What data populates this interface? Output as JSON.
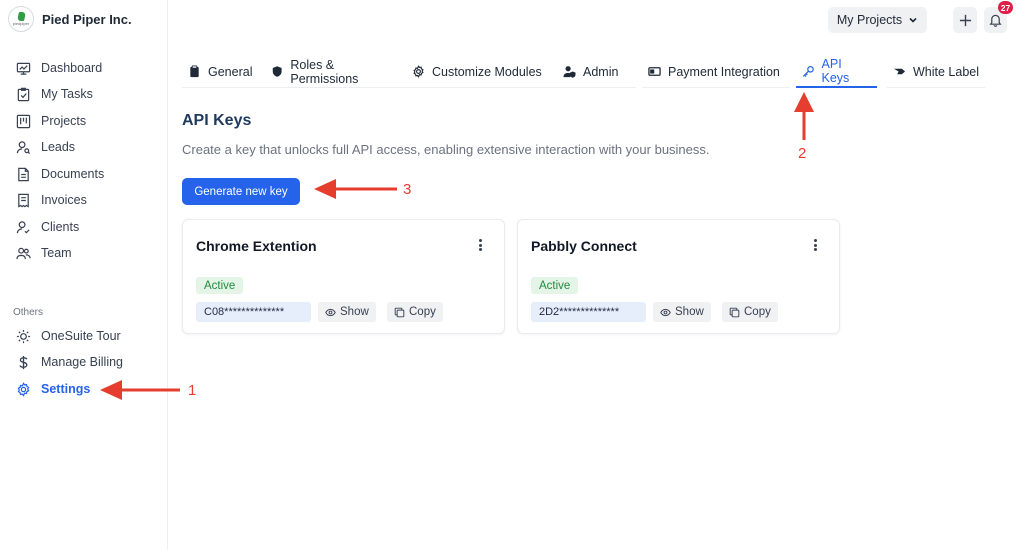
{
  "brand": {
    "name": "Pied Piper Inc.",
    "logo_text": "piedpiper"
  },
  "sidebar": {
    "items": [
      {
        "label": "Dashboard",
        "icon": "monitor-icon"
      },
      {
        "label": "My Tasks",
        "icon": "clipboard-check-icon"
      },
      {
        "label": "Projects",
        "icon": "kanban-icon"
      },
      {
        "label": "Leads",
        "icon": "user-search-icon"
      },
      {
        "label": "Documents",
        "icon": "document-icon"
      },
      {
        "label": "Invoices",
        "icon": "receipt-icon"
      },
      {
        "label": "Clients",
        "icon": "user-check-icon"
      },
      {
        "label": "Team",
        "icon": "users-icon"
      }
    ],
    "others_label": "Others",
    "others": [
      {
        "label": "OneSuite Tour",
        "icon": "sun-icon"
      },
      {
        "label": "Manage Billing",
        "icon": "dollar-icon"
      },
      {
        "label": "Settings",
        "icon": "gear-icon",
        "active": true
      }
    ]
  },
  "topbar": {
    "projects_label": "My Projects",
    "notifications_count": "27"
  },
  "tabs": [
    {
      "label": "General",
      "icon": "clipboard-icon"
    },
    {
      "label": "Roles & Permissions",
      "icon": "shield-icon"
    },
    {
      "label": "Customize Modules",
      "icon": "gear-icon"
    },
    {
      "label": "Admin",
      "icon": "user-shield-icon"
    },
    {
      "label": "Payment Integration",
      "icon": "card-icon"
    },
    {
      "label": "API Keys",
      "icon": "key-icon",
      "active": true
    },
    {
      "label": "White Label",
      "icon": "tag-icon"
    }
  ],
  "main": {
    "title": "API Keys",
    "description": "Create a key that unlocks full API access, enabling extensive interaction with your business.",
    "generate_label": "Generate new key"
  },
  "cards": [
    {
      "title": "Chrome Extention",
      "status": "Active",
      "key": "C08**************",
      "show_label": "Show",
      "copy_label": "Copy"
    },
    {
      "title": "Pabbly Connect",
      "status": "Active",
      "key": "2D2**************",
      "show_label": "Show",
      "copy_label": "Copy"
    }
  ],
  "annotations": {
    "one": "1",
    "two": "2",
    "three": "3",
    "color": "#e53e2f"
  },
  "colors": {
    "accent": "#2563eb",
    "active_badge_bg": "#e4f5e8",
    "active_badge_text": "#218a3d",
    "notification": "#e11d48"
  }
}
